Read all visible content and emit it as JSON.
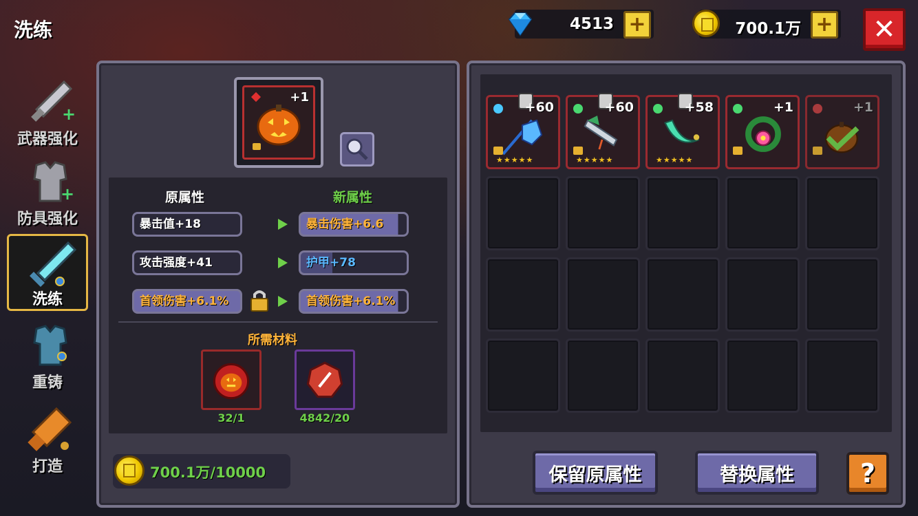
{
  "header": {
    "title": "洗练",
    "gems": "4513",
    "gold": "700.1万",
    "plus_symbol": "+",
    "close_symbol": "✕"
  },
  "nav": {
    "items": [
      {
        "label": "武器强化",
        "icon": "sword-icon"
      },
      {
        "label": "防具强化",
        "icon": "armor-icon"
      },
      {
        "label": "洗练",
        "icon": "refine-sword-icon",
        "active": true
      },
      {
        "label": "重铸",
        "icon": "reforge-armor-icon"
      },
      {
        "label": "打造",
        "icon": "forge-hammer-icon"
      }
    ]
  },
  "selected_item": {
    "level": "+1",
    "icon": "pumpkin-icon"
  },
  "attributes": {
    "old_header": "原属性",
    "new_header": "新属性",
    "rows": [
      {
        "old": "暴击值+18",
        "new": "暴击伤害+6.6"
      },
      {
        "old": "攻击强度+41",
        "new": "护甲+78"
      },
      {
        "old": "首领伤害+6.1%",
        "new": "首领伤害+6.1%",
        "locked": true
      }
    ]
  },
  "materials": {
    "header": "所需材料",
    "items": [
      {
        "count": "32/1",
        "icon": "pumpkin-material-icon"
      },
      {
        "count": "4842/20",
        "icon": "red-stone-icon"
      }
    ]
  },
  "cost": {
    "value": "700.1万/10000"
  },
  "inventory": [
    {
      "level": "+60",
      "icon": "ice-weapon-icon",
      "gem_color": "#4ac8ff",
      "stars": "★★★★★"
    },
    {
      "level": "+60",
      "icon": "syringe-weapon-icon",
      "gem_color": "#4ad870",
      "stars": "★★★★★"
    },
    {
      "level": "+58",
      "icon": "green-blade-icon",
      "gem_color": "#4ad870",
      "stars": "★★★★★"
    },
    {
      "level": "+1",
      "icon": "flower-wreath-icon",
      "gem_color": "#4ad870",
      "stars": ""
    },
    {
      "level": "+1",
      "icon": "pumpkin-checked-icon",
      "gem_color": "#c04040",
      "stars": ""
    }
  ],
  "buttons": {
    "keep": "保留原属性",
    "replace": "替换属性",
    "help": "?"
  },
  "colors": {
    "accent_green": "#6fd04a",
    "accent_orange": "#ffb43a",
    "accent_blue": "#5ab8ff",
    "close_red": "#d8262a"
  }
}
